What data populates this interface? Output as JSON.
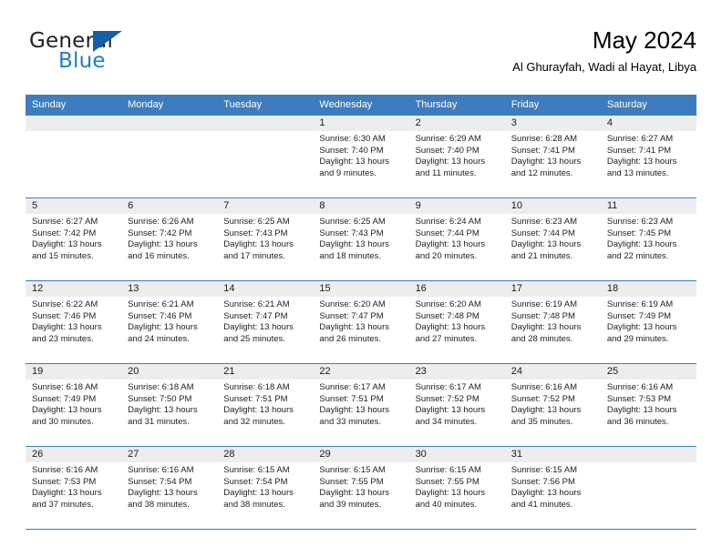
{
  "brand": {
    "name_top": "General",
    "name_bottom": "Blue",
    "accent_color": "#1f7dc4",
    "triangle_color": "#1560a8",
    "triangle_icon": "triangle-icon"
  },
  "header": {
    "title": "May 2024",
    "subtitle": "Al Ghurayfah, Wadi al Hayat, Libya"
  },
  "calendar": {
    "header_bg": "#3d7cbf",
    "header_text_color": "#ffffff",
    "daycell_bg": "#ededed",
    "weekdays": [
      "Sunday",
      "Monday",
      "Tuesday",
      "Wednesday",
      "Thursday",
      "Friday",
      "Saturday"
    ],
    "weeks": [
      [
        {
          "day": "",
          "empty": true
        },
        {
          "day": "",
          "empty": true
        },
        {
          "day": "",
          "empty": true
        },
        {
          "day": "1",
          "sunrise": "Sunrise: 6:30 AM",
          "sunset": "Sunset: 7:40 PM",
          "daylight": "Daylight: 13 hours and 9 minutes."
        },
        {
          "day": "2",
          "sunrise": "Sunrise: 6:29 AM",
          "sunset": "Sunset: 7:40 PM",
          "daylight": "Daylight: 13 hours and 11 minutes."
        },
        {
          "day": "3",
          "sunrise": "Sunrise: 6:28 AM",
          "sunset": "Sunset: 7:41 PM",
          "daylight": "Daylight: 13 hours and 12 minutes."
        },
        {
          "day": "4",
          "sunrise": "Sunrise: 6:27 AM",
          "sunset": "Sunset: 7:41 PM",
          "daylight": "Daylight: 13 hours and 13 minutes."
        }
      ],
      [
        {
          "day": "5",
          "sunrise": "Sunrise: 6:27 AM",
          "sunset": "Sunset: 7:42 PM",
          "daylight": "Daylight: 13 hours and 15 minutes."
        },
        {
          "day": "6",
          "sunrise": "Sunrise: 6:26 AM",
          "sunset": "Sunset: 7:42 PM",
          "daylight": "Daylight: 13 hours and 16 minutes."
        },
        {
          "day": "7",
          "sunrise": "Sunrise: 6:25 AM",
          "sunset": "Sunset: 7:43 PM",
          "daylight": "Daylight: 13 hours and 17 minutes."
        },
        {
          "day": "8",
          "sunrise": "Sunrise: 6:25 AM",
          "sunset": "Sunset: 7:43 PM",
          "daylight": "Daylight: 13 hours and 18 minutes."
        },
        {
          "day": "9",
          "sunrise": "Sunrise: 6:24 AM",
          "sunset": "Sunset: 7:44 PM",
          "daylight": "Daylight: 13 hours and 20 minutes."
        },
        {
          "day": "10",
          "sunrise": "Sunrise: 6:23 AM",
          "sunset": "Sunset: 7:44 PM",
          "daylight": "Daylight: 13 hours and 21 minutes."
        },
        {
          "day": "11",
          "sunrise": "Sunrise: 6:23 AM",
          "sunset": "Sunset: 7:45 PM",
          "daylight": "Daylight: 13 hours and 22 minutes."
        }
      ],
      [
        {
          "day": "12",
          "sunrise": "Sunrise: 6:22 AM",
          "sunset": "Sunset: 7:46 PM",
          "daylight": "Daylight: 13 hours and 23 minutes."
        },
        {
          "day": "13",
          "sunrise": "Sunrise: 6:21 AM",
          "sunset": "Sunset: 7:46 PM",
          "daylight": "Daylight: 13 hours and 24 minutes."
        },
        {
          "day": "14",
          "sunrise": "Sunrise: 6:21 AM",
          "sunset": "Sunset: 7:47 PM",
          "daylight": "Daylight: 13 hours and 25 minutes."
        },
        {
          "day": "15",
          "sunrise": "Sunrise: 6:20 AM",
          "sunset": "Sunset: 7:47 PM",
          "daylight": "Daylight: 13 hours and 26 minutes."
        },
        {
          "day": "16",
          "sunrise": "Sunrise: 6:20 AM",
          "sunset": "Sunset: 7:48 PM",
          "daylight": "Daylight: 13 hours and 27 minutes."
        },
        {
          "day": "17",
          "sunrise": "Sunrise: 6:19 AM",
          "sunset": "Sunset: 7:48 PM",
          "daylight": "Daylight: 13 hours and 28 minutes."
        },
        {
          "day": "18",
          "sunrise": "Sunrise: 6:19 AM",
          "sunset": "Sunset: 7:49 PM",
          "daylight": "Daylight: 13 hours and 29 minutes."
        }
      ],
      [
        {
          "day": "19",
          "sunrise": "Sunrise: 6:18 AM",
          "sunset": "Sunset: 7:49 PM",
          "daylight": "Daylight: 13 hours and 30 minutes."
        },
        {
          "day": "20",
          "sunrise": "Sunrise: 6:18 AM",
          "sunset": "Sunset: 7:50 PM",
          "daylight": "Daylight: 13 hours and 31 minutes."
        },
        {
          "day": "21",
          "sunrise": "Sunrise: 6:18 AM",
          "sunset": "Sunset: 7:51 PM",
          "daylight": "Daylight: 13 hours and 32 minutes."
        },
        {
          "day": "22",
          "sunrise": "Sunrise: 6:17 AM",
          "sunset": "Sunset: 7:51 PM",
          "daylight": "Daylight: 13 hours and 33 minutes."
        },
        {
          "day": "23",
          "sunrise": "Sunrise: 6:17 AM",
          "sunset": "Sunset: 7:52 PM",
          "daylight": "Daylight: 13 hours and 34 minutes."
        },
        {
          "day": "24",
          "sunrise": "Sunrise: 6:16 AM",
          "sunset": "Sunset: 7:52 PM",
          "daylight": "Daylight: 13 hours and 35 minutes."
        },
        {
          "day": "25",
          "sunrise": "Sunrise: 6:16 AM",
          "sunset": "Sunset: 7:53 PM",
          "daylight": "Daylight: 13 hours and 36 minutes."
        }
      ],
      [
        {
          "day": "26",
          "sunrise": "Sunrise: 6:16 AM",
          "sunset": "Sunset: 7:53 PM",
          "daylight": "Daylight: 13 hours and 37 minutes."
        },
        {
          "day": "27",
          "sunrise": "Sunrise: 6:16 AM",
          "sunset": "Sunset: 7:54 PM",
          "daylight": "Daylight: 13 hours and 38 minutes."
        },
        {
          "day": "28",
          "sunrise": "Sunrise: 6:15 AM",
          "sunset": "Sunset: 7:54 PM",
          "daylight": "Daylight: 13 hours and 38 minutes."
        },
        {
          "day": "29",
          "sunrise": "Sunrise: 6:15 AM",
          "sunset": "Sunset: 7:55 PM",
          "daylight": "Daylight: 13 hours and 39 minutes."
        },
        {
          "day": "30",
          "sunrise": "Sunrise: 6:15 AM",
          "sunset": "Sunset: 7:55 PM",
          "daylight": "Daylight: 13 hours and 40 minutes."
        },
        {
          "day": "31",
          "sunrise": "Sunrise: 6:15 AM",
          "sunset": "Sunset: 7:56 PM",
          "daylight": "Daylight: 13 hours and 41 minutes."
        },
        {
          "day": "",
          "empty": true
        }
      ]
    ]
  }
}
